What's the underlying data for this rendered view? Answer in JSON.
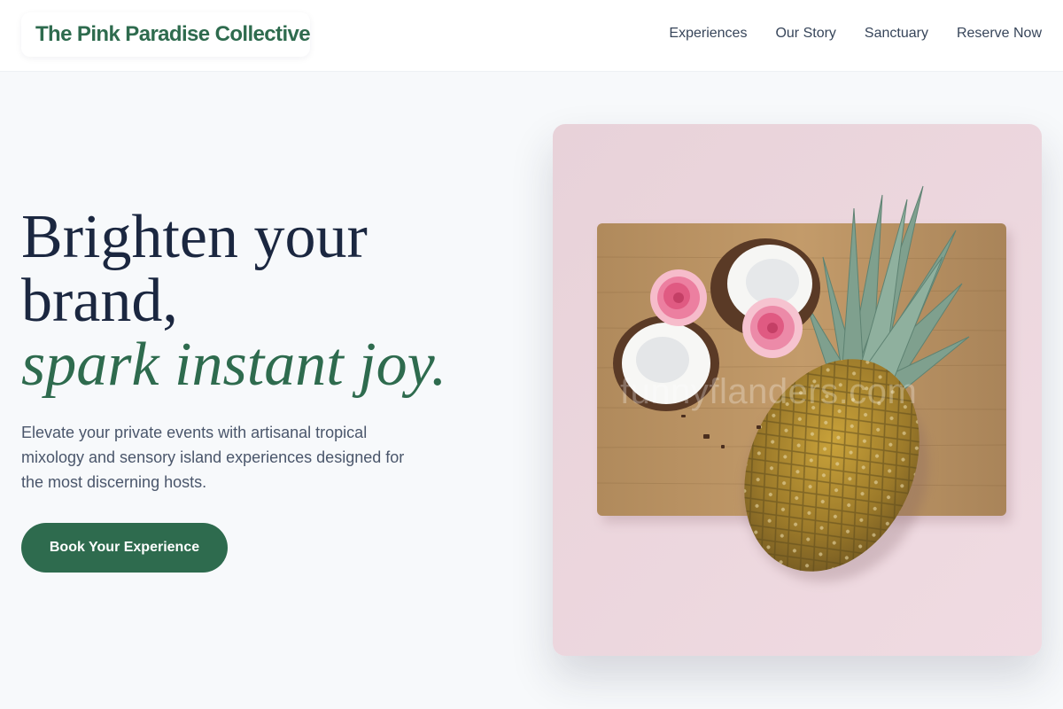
{
  "brand": {
    "name": "The Pink Paradise Collective",
    "accent_color": "#2e6b4e"
  },
  "nav": {
    "items": [
      "Experiences",
      "Our Story",
      "Sanctuary",
      "Reserve Now"
    ]
  },
  "hero": {
    "headline_line1": "Brighten your",
    "headline_line2": "brand,",
    "headline_accent": "spark instant joy.",
    "subtext": "Elevate your private events with artisanal tropical mixology and sensory island experiences designed for the most discerning hosts.",
    "cta_label": "Book Your Experience"
  },
  "image": {
    "subject": "pineapple-coconut-flowers-on-cutting-board",
    "background_color": "#eed6dd",
    "watermark": "funnyflanders.com"
  }
}
